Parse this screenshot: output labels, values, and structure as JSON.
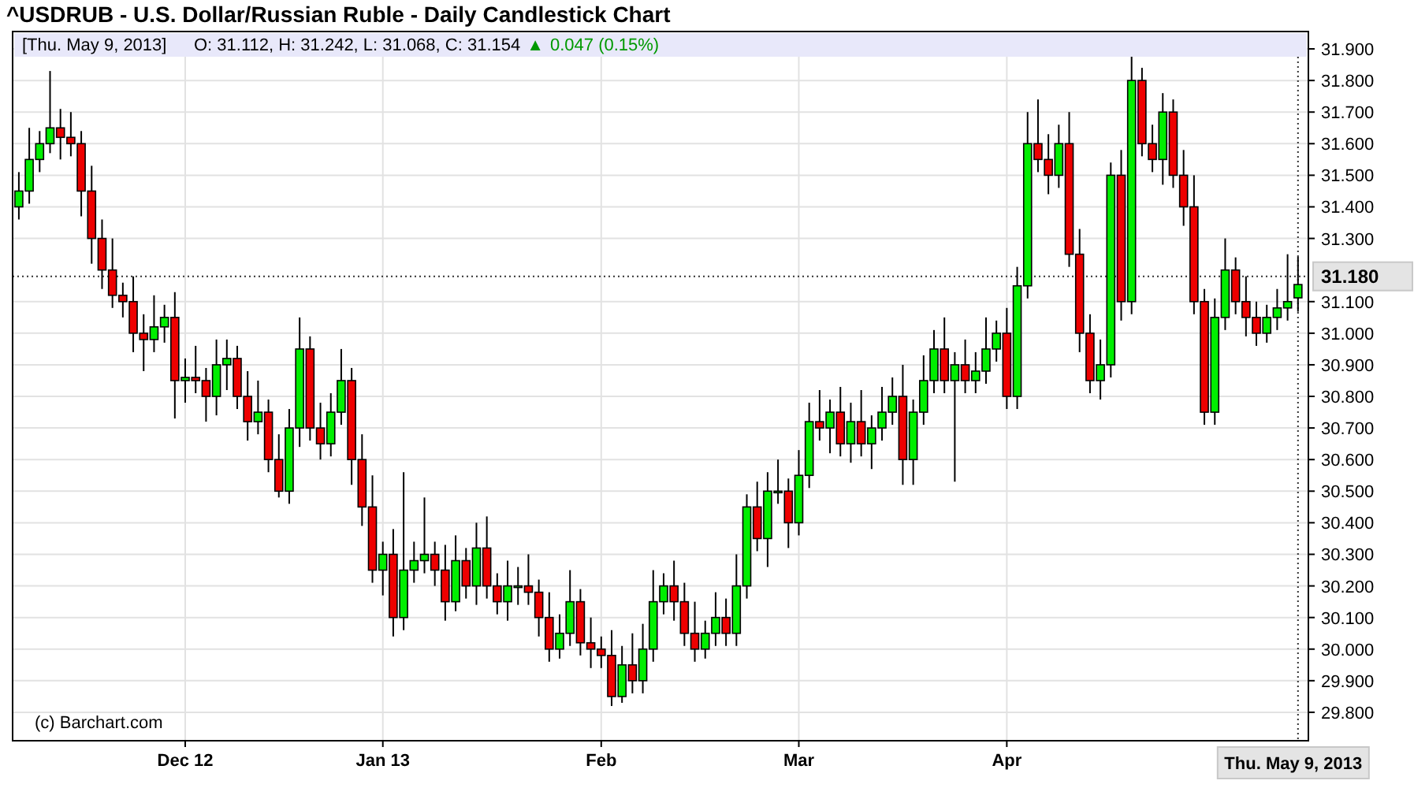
{
  "title": "^USDRUB - U.S. Dollar/Russian Ruble - Daily Candlestick Chart",
  "info_bar": {
    "date": "[Thu. May 9, 2013]",
    "ohlc": "O: 31.112, H: 31.242, L: 31.068, C: 31.154",
    "change_arrow": "▲",
    "change": "0.047 (0.15%)"
  },
  "chart": {
    "credit": "(c) Barchart.com",
    "chart_data": {
      "type": "candlestick",
      "grid": true,
      "ylim": [
        29.71,
        31.955
      ],
      "yticks": [
        {
          "value": 29.8,
          "label": "29.800"
        },
        {
          "value": 29.9,
          "label": "29.900"
        },
        {
          "value": 30.0,
          "label": "30.000"
        },
        {
          "value": 30.1,
          "label": "30.100"
        },
        {
          "value": 30.2,
          "label": "30.200"
        },
        {
          "value": 30.3,
          "label": "30.300"
        },
        {
          "value": 30.4,
          "label": "30.400"
        },
        {
          "value": 30.5,
          "label": "30.500"
        },
        {
          "value": 30.6,
          "label": "30.600"
        },
        {
          "value": 30.7,
          "label": "30.700"
        },
        {
          "value": 30.8,
          "label": "30.800"
        },
        {
          "value": 30.9,
          "label": "30.900"
        },
        {
          "value": 31.0,
          "label": "31.000"
        },
        {
          "value": 31.1,
          "label": "31.100"
        },
        {
          "value": 31.3,
          "label": "31.300"
        },
        {
          "value": 31.4,
          "label": "31.400"
        },
        {
          "value": 31.5,
          "label": "31.500"
        },
        {
          "value": 31.6,
          "label": "31.600"
        },
        {
          "value": 31.7,
          "label": "31.700"
        },
        {
          "value": 31.8,
          "label": "31.800"
        },
        {
          "value": 31.9,
          "label": "31.900"
        }
      ],
      "categories": [
        null,
        null,
        null,
        null,
        null,
        null,
        null,
        null,
        null,
        null,
        null,
        null,
        null,
        null,
        null,
        null,
        "Dec 12",
        null,
        null,
        null,
        null,
        null,
        null,
        null,
        null,
        null,
        null,
        null,
        null,
        null,
        null,
        null,
        null,
        null,
        null,
        "Jan 13",
        null,
        null,
        null,
        null,
        null,
        null,
        null,
        null,
        null,
        null,
        null,
        null,
        null,
        null,
        null,
        null,
        null,
        null,
        null,
        null,
        "Feb",
        null,
        null,
        null,
        null,
        null,
        null,
        null,
        null,
        null,
        null,
        null,
        null,
        null,
        null,
        null,
        null,
        null,
        null,
        "Mar",
        null,
        null,
        null,
        null,
        null,
        null,
        null,
        null,
        null,
        null,
        null,
        null,
        null,
        null,
        null,
        null,
        null,
        null,
        null,
        "Apr",
        null,
        null,
        null,
        null,
        null,
        null,
        null,
        null,
        null,
        null,
        null,
        null,
        null,
        null,
        null,
        null,
        null,
        null,
        null,
        null,
        null,
        null,
        null,
        null,
        null,
        null,
        null,
        null
      ],
      "ohlc": [
        [
          31.4,
          31.51,
          31.36,
          31.45
        ],
        [
          31.45,
          31.65,
          31.41,
          31.55
        ],
        [
          31.55,
          31.64,
          31.51,
          31.6
        ],
        [
          31.6,
          31.83,
          31.57,
          31.65
        ],
        [
          31.65,
          31.71,
          31.55,
          31.62
        ],
        [
          31.62,
          31.7,
          31.56,
          31.6
        ],
        [
          31.6,
          31.64,
          31.37,
          31.45
        ],
        [
          31.45,
          31.53,
          31.22,
          31.3
        ],
        [
          31.3,
          31.36,
          31.14,
          31.2
        ],
        [
          31.2,
          31.3,
          31.08,
          31.12
        ],
        [
          31.12,
          31.16,
          31.05,
          31.1
        ],
        [
          31.1,
          31.18,
          30.94,
          31.0
        ],
        [
          31.0,
          31.06,
          30.88,
          30.98
        ],
        [
          30.98,
          31.12,
          30.94,
          31.02
        ],
        [
          31.02,
          31.09,
          30.97,
          31.05
        ],
        [
          31.05,
          31.13,
          30.73,
          30.85
        ],
        [
          30.85,
          30.92,
          30.78,
          30.86
        ],
        [
          30.86,
          30.96,
          30.81,
          30.85
        ],
        [
          30.85,
          30.89,
          30.72,
          30.8
        ],
        [
          30.8,
          30.98,
          30.74,
          30.9
        ],
        [
          30.9,
          30.98,
          30.82,
          30.92
        ],
        [
          30.92,
          30.96,
          30.76,
          30.8
        ],
        [
          30.8,
          30.88,
          30.66,
          30.72
        ],
        [
          30.72,
          30.85,
          30.68,
          30.75
        ],
        [
          30.75,
          30.79,
          30.56,
          30.6
        ],
        [
          30.6,
          30.68,
          30.48,
          30.5
        ],
        [
          30.5,
          30.76,
          30.46,
          30.7
        ],
        [
          30.7,
          31.05,
          30.64,
          30.95
        ],
        [
          30.95,
          30.99,
          30.66,
          30.7
        ],
        [
          30.7,
          30.78,
          30.6,
          30.65
        ],
        [
          30.65,
          30.81,
          30.61,
          30.75
        ],
        [
          30.75,
          30.95,
          30.71,
          30.85
        ],
        [
          30.85,
          30.89,
          30.52,
          30.6
        ],
        [
          30.6,
          30.68,
          30.39,
          30.45
        ],
        [
          30.45,
          30.55,
          30.21,
          30.25
        ],
        [
          30.25,
          30.34,
          30.17,
          30.3
        ],
        [
          30.3,
          30.38,
          30.04,
          30.1
        ],
        [
          30.1,
          30.56,
          30.06,
          30.25
        ],
        [
          30.25,
          30.34,
          30.21,
          30.28
        ],
        [
          30.28,
          30.48,
          30.24,
          30.3
        ],
        [
          30.3,
          30.34,
          30.2,
          30.25
        ],
        [
          30.25,
          30.33,
          30.09,
          30.15
        ],
        [
          30.15,
          30.36,
          30.12,
          30.28
        ],
        [
          30.28,
          30.32,
          30.16,
          30.2
        ],
        [
          30.2,
          30.4,
          30.14,
          30.32
        ],
        [
          30.32,
          30.42,
          30.16,
          30.2
        ],
        [
          30.2,
          30.24,
          30.11,
          30.15
        ],
        [
          30.15,
          30.28,
          30.09,
          30.2
        ],
        [
          30.2,
          30.26,
          30.14,
          30.2
        ],
        [
          30.2,
          30.3,
          30.14,
          30.18
        ],
        [
          30.18,
          30.22,
          30.04,
          30.1
        ],
        [
          30.1,
          30.18,
          29.96,
          30.0
        ],
        [
          30.0,
          30.11,
          29.97,
          30.05
        ],
        [
          30.05,
          30.25,
          30.01,
          30.15
        ],
        [
          30.15,
          30.19,
          29.98,
          30.02
        ],
        [
          30.02,
          30.1,
          29.94,
          30.0
        ],
        [
          30.0,
          30.04,
          29.94,
          29.98
        ],
        [
          29.98,
          30.06,
          29.82,
          29.85
        ],
        [
          29.85,
          30.01,
          29.83,
          29.95
        ],
        [
          29.95,
          30.05,
          29.86,
          29.9
        ],
        [
          29.9,
          30.08,
          29.86,
          30.0
        ],
        [
          30.0,
          30.25,
          29.96,
          30.15
        ],
        [
          30.15,
          30.24,
          30.11,
          30.2
        ],
        [
          30.2,
          30.28,
          30.09,
          30.15
        ],
        [
          30.15,
          30.21,
          30.01,
          30.05
        ],
        [
          30.05,
          30.15,
          29.96,
          30.0
        ],
        [
          30.0,
          30.09,
          29.97,
          30.05
        ],
        [
          30.05,
          30.18,
          30.01,
          30.1
        ],
        [
          30.1,
          30.16,
          30.01,
          30.05
        ],
        [
          30.05,
          30.3,
          30.01,
          30.2
        ],
        [
          30.2,
          30.49,
          30.16,
          30.45
        ],
        [
          30.45,
          30.53,
          30.31,
          30.35
        ],
        [
          30.35,
          30.56,
          30.26,
          30.5
        ],
        [
          30.5,
          30.6,
          30.46,
          30.5
        ],
        [
          30.5,
          30.54,
          30.32,
          30.4
        ],
        [
          30.4,
          30.63,
          30.36,
          30.55
        ],
        [
          30.55,
          30.78,
          30.51,
          30.72
        ],
        [
          30.72,
          30.82,
          30.66,
          30.7
        ],
        [
          30.7,
          30.79,
          30.62,
          30.75
        ],
        [
          30.75,
          30.83,
          30.61,
          30.65
        ],
        [
          30.65,
          30.78,
          30.59,
          30.72
        ],
        [
          30.72,
          30.82,
          30.61,
          30.65
        ],
        [
          30.65,
          30.74,
          30.57,
          30.7
        ],
        [
          30.7,
          30.83,
          30.66,
          30.75
        ],
        [
          30.75,
          30.86,
          30.71,
          30.8
        ],
        [
          30.8,
          30.9,
          30.52,
          30.6
        ],
        [
          30.6,
          30.79,
          30.52,
          30.75
        ],
        [
          30.75,
          30.93,
          30.71,
          30.85
        ],
        [
          30.85,
          31.01,
          30.81,
          30.95
        ],
        [
          30.95,
          31.05,
          30.81,
          30.85
        ],
        [
          30.85,
          30.94,
          30.53,
          30.9
        ],
        [
          30.9,
          30.98,
          30.81,
          30.85
        ],
        [
          30.85,
          30.94,
          30.81,
          30.88
        ],
        [
          30.88,
          31.05,
          30.84,
          30.95
        ],
        [
          30.95,
          31.04,
          30.91,
          31.0
        ],
        [
          31.0,
          31.08,
          30.76,
          30.8
        ],
        [
          30.8,
          31.21,
          30.76,
          31.15
        ],
        [
          31.15,
          31.7,
          31.11,
          31.6
        ],
        [
          31.6,
          31.74,
          31.51,
          31.55
        ],
        [
          31.55,
          31.63,
          31.44,
          31.5
        ],
        [
          31.5,
          31.66,
          31.46,
          31.6
        ],
        [
          31.6,
          31.7,
          31.21,
          31.25
        ],
        [
          31.25,
          31.33,
          30.94,
          31.0
        ],
        [
          31.0,
          31.06,
          30.81,
          30.85
        ],
        [
          30.85,
          30.98,
          30.79,
          30.9
        ],
        [
          30.9,
          31.54,
          30.86,
          31.5
        ],
        [
          31.5,
          31.58,
          31.04,
          31.1
        ],
        [
          31.1,
          31.88,
          31.06,
          31.8
        ],
        [
          31.8,
          31.84,
          31.56,
          31.6
        ],
        [
          31.6,
          31.66,
          31.51,
          31.55
        ],
        [
          31.55,
          31.76,
          31.47,
          31.7
        ],
        [
          31.7,
          31.74,
          31.46,
          31.5
        ],
        [
          31.5,
          31.58,
          31.34,
          31.4
        ],
        [
          31.4,
          31.5,
          31.06,
          31.1
        ],
        [
          31.1,
          31.14,
          30.71,
          30.75
        ],
        [
          30.75,
          31.11,
          30.71,
          31.05
        ],
        [
          31.05,
          31.3,
          31.01,
          31.2
        ],
        [
          31.2,
          31.24,
          31.06,
          31.1
        ],
        [
          31.1,
          31.18,
          30.99,
          31.05
        ],
        [
          31.05,
          31.1,
          30.96,
          31.0
        ],
        [
          31.0,
          31.09,
          30.97,
          31.05
        ],
        [
          31.05,
          31.14,
          31.01,
          31.08
        ],
        [
          31.08,
          31.25,
          31.04,
          31.1
        ],
        [
          31.112,
          31.242,
          31.068,
          31.154
        ]
      ],
      "ref_lines": [
        {
          "axis": "y",
          "value": 31.18,
          "label": "31.180"
        }
      ]
    },
    "cursor_date": "Thu. May 9, 2013"
  }
}
